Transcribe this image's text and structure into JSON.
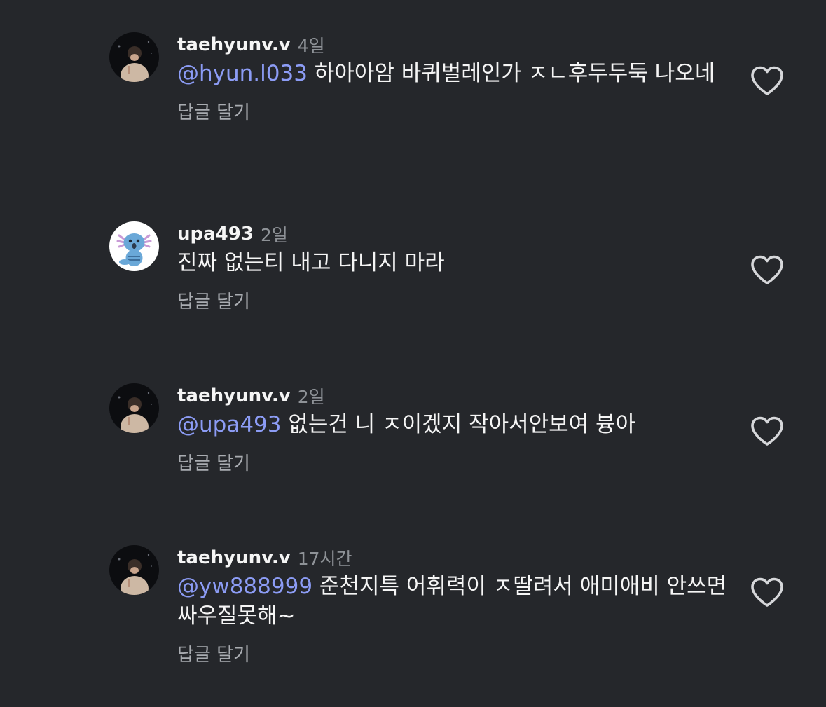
{
  "reply_label": "답글 달기",
  "colors": {
    "background": "#25272b",
    "mention": "#8c9cf5",
    "username": "#f5f5f5",
    "timestamp": "#8e9297"
  },
  "comments": [
    {
      "username": "taehyunv.v",
      "time": "4일",
      "mention": "@hyun.l033",
      "text": " 하아아암 바퀴벌레인가 ㅈㄴ후두두둑 나오네",
      "avatar": "night-photo-avatar",
      "like_icon": "heart-outline-icon"
    },
    {
      "username": "upa493",
      "time": "2일",
      "mention": "",
      "text": "진짜 없는티 내고 다니지 마라",
      "avatar": "wooper-avatar",
      "like_icon": "heart-outline-icon"
    },
    {
      "username": "taehyunv.v",
      "time": "2일",
      "mention": "@upa493",
      "text": " 없는건 니 ㅈ이겠지 작아서안보여 븅아",
      "avatar": "night-photo-avatar",
      "like_icon": "heart-outline-icon"
    },
    {
      "username": "taehyunv.v",
      "time": "17시간",
      "mention": "@yw888999",
      "text": " 준천지특 어휘력이 ㅈ딸려서 애미애비 안쓰면 싸우질못해~",
      "avatar": "night-photo-avatar",
      "like_icon": "heart-outline-icon"
    }
  ]
}
